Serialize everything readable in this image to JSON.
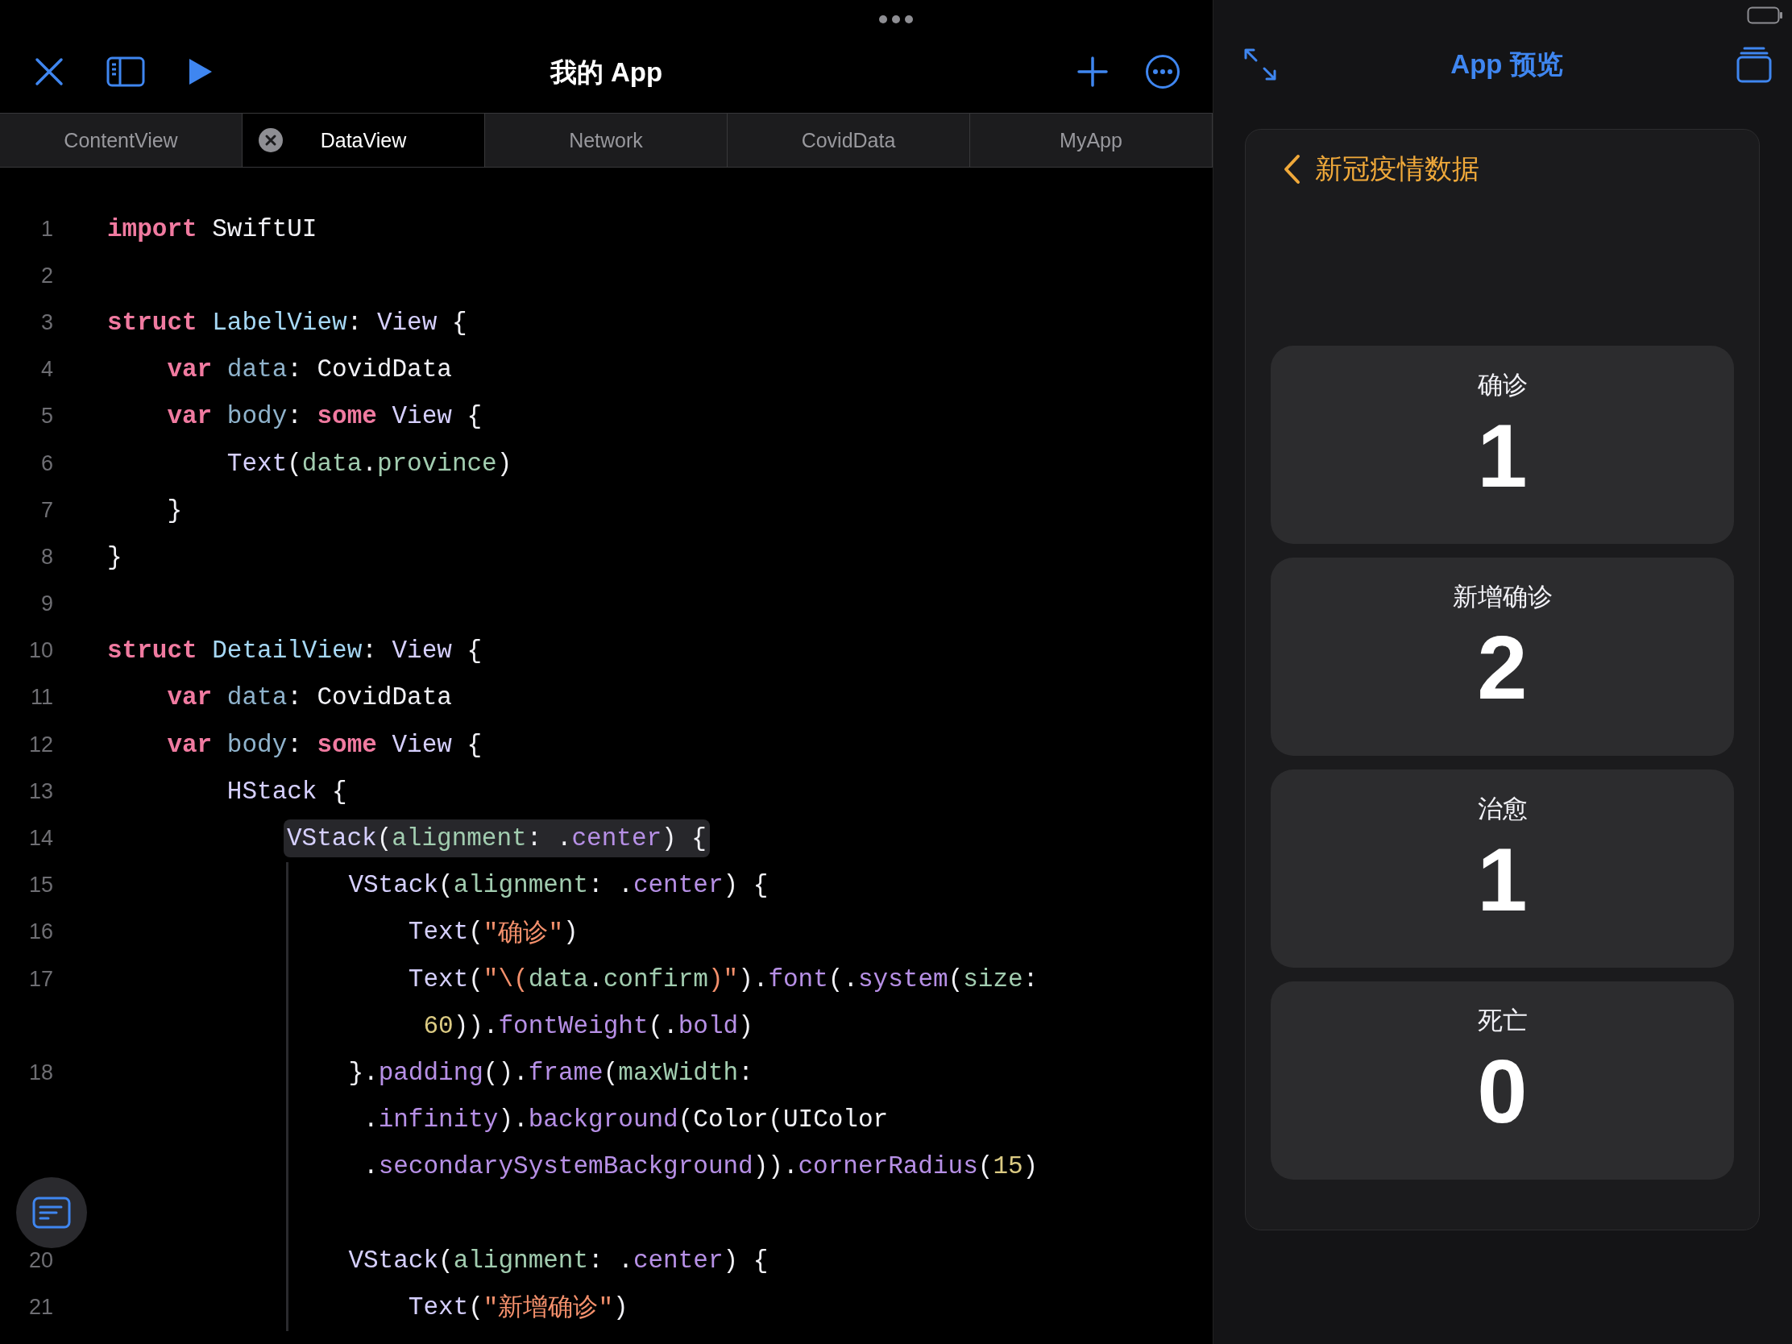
{
  "editor": {
    "title": "我的 App",
    "tabs": [
      {
        "label": "ContentView",
        "selected": false
      },
      {
        "label": "DataView",
        "selected": true
      },
      {
        "label": "Network",
        "selected": false
      },
      {
        "label": "CovidData",
        "selected": false
      },
      {
        "label": "MyApp",
        "selected": false
      }
    ],
    "lines": [
      {
        "n": "1",
        "tokens": [
          {
            "kw": "import"
          },
          {
            "plain": " SwiftUI"
          }
        ]
      },
      {
        "n": "2"
      },
      {
        "n": "3",
        "tokens": [
          {
            "kw": "struct"
          },
          {
            "decl": " LabelView"
          },
          {
            "plain": ": "
          },
          {
            "type": "View"
          },
          {
            "plain": " {"
          }
        ]
      },
      {
        "n": "4",
        "tokens": [
          {
            "kw": "    var"
          },
          {
            "var": " data"
          },
          {
            "plain": ": CovidData"
          }
        ]
      },
      {
        "n": "5",
        "tokens": [
          {
            "kw": "    var"
          },
          {
            "var": " body"
          },
          {
            "plain": ": "
          },
          {
            "kw": "some"
          },
          {
            "type": " View"
          },
          {
            "plain": " {"
          }
        ]
      },
      {
        "n": "6",
        "tokens": [
          {
            "type": "        Text"
          },
          {
            "plain": "("
          },
          {
            "ident": "data"
          },
          {
            "plain": "."
          },
          {
            "ident": "province"
          },
          {
            "plain": ")"
          }
        ]
      },
      {
        "n": "7",
        "tokens": [
          {
            "plain": "    }"
          }
        ]
      },
      {
        "n": "8",
        "tokens": [
          {
            "plain": "}"
          }
        ]
      },
      {
        "n": "9"
      },
      {
        "n": "10",
        "tokens": [
          {
            "kw": "struct"
          },
          {
            "decl": " DetailView"
          },
          {
            "plain": ": "
          },
          {
            "type": "View"
          },
          {
            "plain": " {"
          }
        ]
      },
      {
        "n": "11",
        "tokens": [
          {
            "kw": "    var"
          },
          {
            "var": " data"
          },
          {
            "plain": ": CovidData"
          }
        ]
      },
      {
        "n": "12",
        "tokens": [
          {
            "kw": "    var"
          },
          {
            "var": " body"
          },
          {
            "plain": ": "
          },
          {
            "kw": "some"
          },
          {
            "type": " View"
          },
          {
            "plain": " {"
          }
        ]
      },
      {
        "n": "13",
        "tokens": [
          {
            "type": "        HStack"
          },
          {
            "plain": " {"
          }
        ]
      },
      {
        "n": "14",
        "highlight": true,
        "tokens": [
          {
            "type": "VStack"
          },
          {
            "plain": "("
          },
          {
            "ident": "alignment"
          },
          {
            "plain": ": ."
          },
          {
            "member": "center"
          },
          {
            "plain": ") {"
          }
        ]
      },
      {
        "n": "15",
        "guide": true,
        "tokens": [
          {
            "type": "    VStack"
          },
          {
            "plain": "("
          },
          {
            "ident": "alignment"
          },
          {
            "plain": ": ."
          },
          {
            "member": "center"
          },
          {
            "plain": ") {"
          }
        ]
      },
      {
        "n": "16",
        "guide": true,
        "tokens": [
          {
            "type": "        Text"
          },
          {
            "plain": "("
          },
          {
            "str": "\"确诊\""
          },
          {
            "plain": ")"
          }
        ]
      },
      {
        "n": "17",
        "guide": true,
        "tokens": [
          {
            "type": "        Text"
          },
          {
            "plain": "("
          },
          {
            "str": "\"\\("
          },
          {
            "ident": "data"
          },
          {
            "plain": "."
          },
          {
            "ident": "confirm"
          },
          {
            "str": ")\""
          },
          {
            "plain": ")."
          },
          {
            "member": "font"
          },
          {
            "plain": "(."
          },
          {
            "member": "system"
          },
          {
            "plain": "("
          },
          {
            "ident": "size"
          },
          {
            "plain": ":"
          }
        ]
      },
      {
        "guide": true,
        "tokens": [
          {
            "num": "         60"
          },
          {
            "plain": "))."
          },
          {
            "member": "fontWeight"
          },
          {
            "plain": "(."
          },
          {
            "member": "bold"
          },
          {
            "plain": ")"
          }
        ]
      },
      {
        "n": "18",
        "guide": true,
        "tokens": [
          {
            "plain": "    }."
          },
          {
            "member": "padding"
          },
          {
            "plain": "()."
          },
          {
            "member": "frame"
          },
          {
            "plain": "("
          },
          {
            "ident": "maxWidth"
          },
          {
            "plain": ":"
          }
        ]
      },
      {
        "guide": true,
        "tokens": [
          {
            "plain": "     ."
          },
          {
            "member": "infinity"
          },
          {
            "plain": ")."
          },
          {
            "member": "background"
          },
          {
            "plain": "(Color(UIColor"
          }
        ]
      },
      {
        "guide": true,
        "tokens": [
          {
            "plain": "     ."
          },
          {
            "member": "secondarySystemBackground"
          },
          {
            "plain": "))."
          },
          {
            "member": "cornerRadius"
          },
          {
            "plain": "("
          },
          {
            "num": "15"
          },
          {
            "plain": ")"
          }
        ]
      },
      {
        "guide": true
      },
      {
        "n": "20",
        "guide": true,
        "tokens": [
          {
            "type": "    VStack"
          },
          {
            "plain": "("
          },
          {
            "ident": "alignment"
          },
          {
            "plain": ": ."
          },
          {
            "member": "center"
          },
          {
            "plain": ") {"
          }
        ]
      },
      {
        "n": "21",
        "guide": true,
        "tokens": [
          {
            "type": "        Text"
          },
          {
            "plain": "("
          },
          {
            "str": "\"新增确诊\""
          },
          {
            "plain": ")"
          }
        ]
      }
    ]
  },
  "preview": {
    "title": "App 预览",
    "back_label": "新冠疫情数据",
    "stats": [
      {
        "label": "确诊",
        "value": "1"
      },
      {
        "label": "新增确诊",
        "value": "2"
      },
      {
        "label": "治愈",
        "value": "1"
      },
      {
        "label": "死亡",
        "value": "0"
      }
    ]
  }
}
